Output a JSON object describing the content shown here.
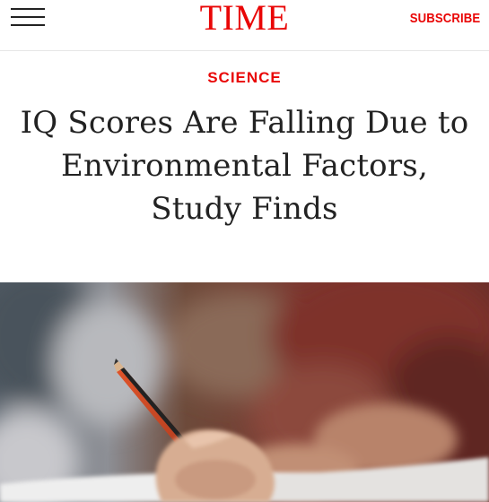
{
  "header": {
    "brand": "TIME",
    "subscribe_label": "SUBSCRIBE",
    "menu_icon": "hamburger-menu-icon",
    "brand_color": "#e90606"
  },
  "article": {
    "section": "SCIENCE",
    "headline": "IQ Scores Are Falling Due to Environmental Factors, Study Finds"
  },
  "hero": {
    "subject": "hand-writing-with-pencil"
  }
}
